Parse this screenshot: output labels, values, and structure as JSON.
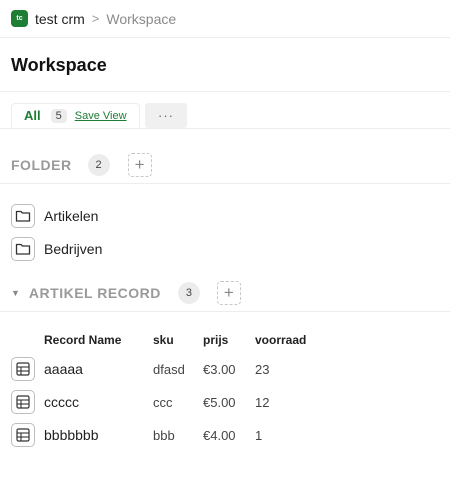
{
  "header": {
    "logo_text": "tc",
    "app_name": "test crm",
    "separator": ">",
    "current": "Workspace"
  },
  "page": {
    "title": "Workspace"
  },
  "views": {
    "all_label": "All",
    "all_count": "5",
    "save_view": "Save View",
    "more_label": "···"
  },
  "folder_section": {
    "title": "FOLDER",
    "count": "2",
    "add": "+",
    "items": [
      {
        "label": "Artikelen"
      },
      {
        "label": "Bedrijven"
      }
    ]
  },
  "record_section": {
    "caret": "▼",
    "title": "ARTIKEL RECORD",
    "count": "3",
    "add": "+",
    "columns": [
      "Record Name",
      "sku",
      "prijs",
      "voorraad"
    ],
    "rows": [
      {
        "name": "aaaaa",
        "sku": "dfasd",
        "prijs": "€3.00",
        "voorraad": "23"
      },
      {
        "name": "ccccc",
        "sku": "ccc",
        "prijs": "€5.00",
        "voorraad": "12"
      },
      {
        "name": "bbbbbbb",
        "sku": "bbb",
        "prijs": "€4.00",
        "voorraad": "1"
      }
    ]
  },
  "colors": {
    "accent": "#1e7e34",
    "muted": "#9a9a9a",
    "border": "#ededed"
  },
  "icons": {
    "folder": "folder-icon",
    "table": "table-icon",
    "plus": "plus-icon",
    "caret": "caret-down-icon"
  }
}
